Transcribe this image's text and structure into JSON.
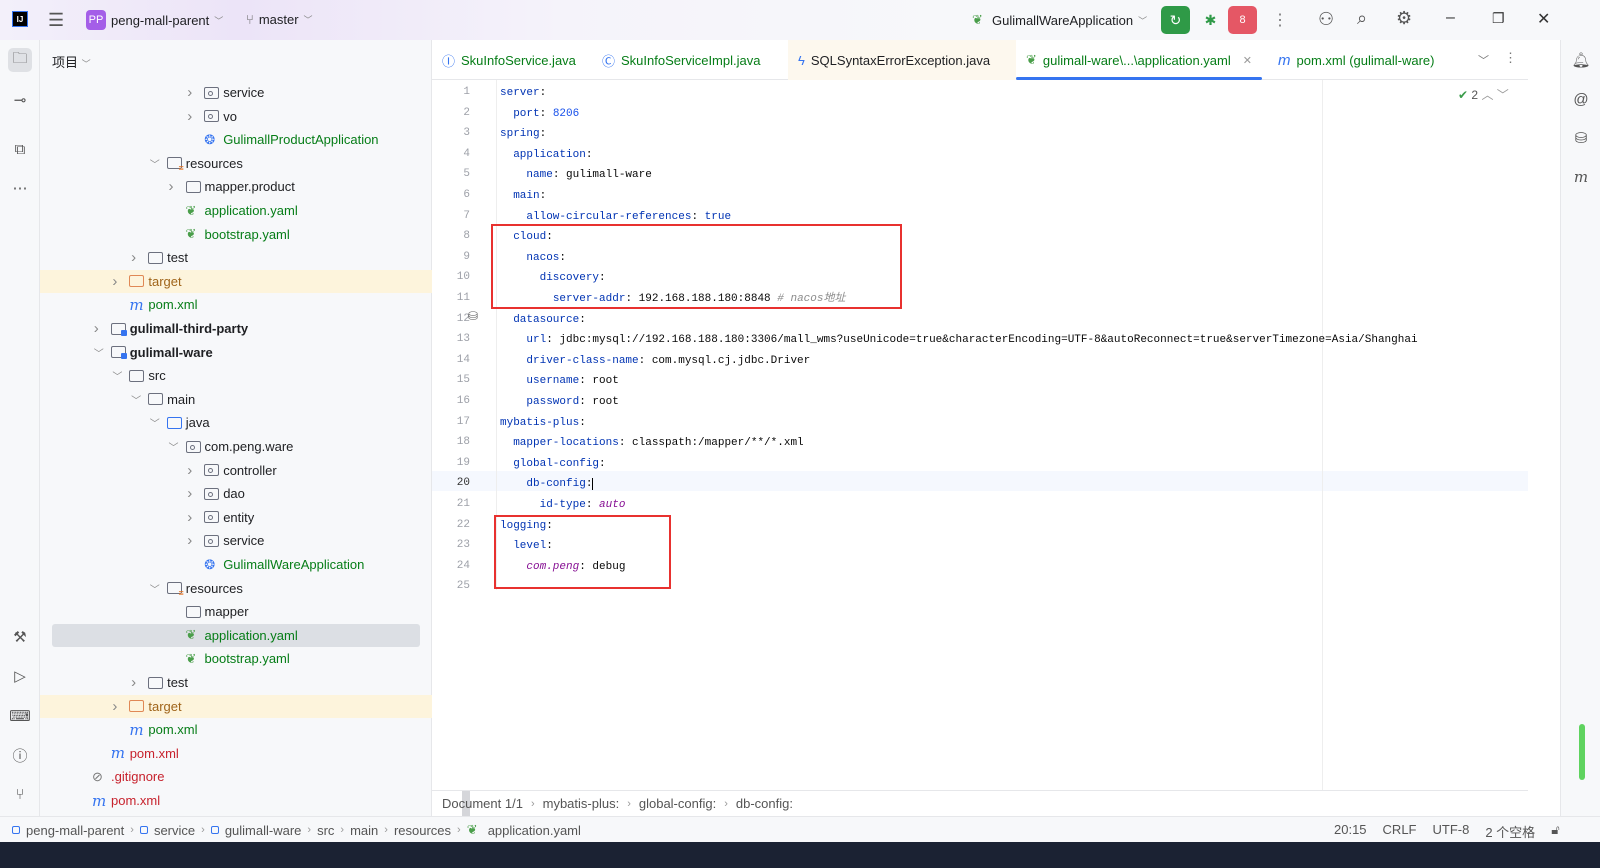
{
  "titlebar": {
    "project_badge": "PP",
    "project": "peng-mall-parent",
    "branch": "master",
    "run_config": "GulimallWareApplication",
    "debug_count": "8"
  },
  "project_panel": {
    "title": "项目"
  },
  "tree": [
    {
      "label": "service",
      "depth": 6,
      "chev": "closed",
      "icon": "package"
    },
    {
      "label": "vo",
      "depth": 6,
      "chev": "closed",
      "icon": "package"
    },
    {
      "label": "GulimallProductApplication",
      "depth": 6,
      "icon": "spring-app",
      "color": "green"
    },
    {
      "label": "resources",
      "depth": 4,
      "chev": "open",
      "icon": "resources"
    },
    {
      "label": "mapper.product",
      "depth": 5,
      "chev": "closed",
      "icon": "folder"
    },
    {
      "label": "application.yaml",
      "depth": 5,
      "icon": "yaml",
      "color": "green"
    },
    {
      "label": "bootstrap.yaml",
      "depth": 5,
      "icon": "yaml",
      "color": "green"
    },
    {
      "label": "test",
      "depth": 3,
      "chev": "closed",
      "icon": "folder"
    },
    {
      "label": "target",
      "depth": 2,
      "chev": "closed",
      "icon": "excluded-folder",
      "color": "gold",
      "highlight": true
    },
    {
      "label": "pom.xml",
      "depth": 2,
      "icon": "maven",
      "color": "green"
    },
    {
      "label": "gulimall-third-party",
      "depth": 1,
      "chev": "closed",
      "icon": "module",
      "bold": true
    },
    {
      "label": "gulimall-ware",
      "depth": 1,
      "chev": "open",
      "icon": "module",
      "bold": true
    },
    {
      "label": "src",
      "depth": 2,
      "chev": "open",
      "icon": "folder"
    },
    {
      "label": "main",
      "depth": 3,
      "chev": "open",
      "icon": "folder"
    },
    {
      "label": "java",
      "depth": 4,
      "chev": "open",
      "icon": "source-folder"
    },
    {
      "label": "com.peng.ware",
      "depth": 5,
      "chev": "open",
      "icon": "package"
    },
    {
      "label": "controller",
      "depth": 6,
      "chev": "closed",
      "icon": "package"
    },
    {
      "label": "dao",
      "depth": 6,
      "chev": "closed",
      "icon": "package"
    },
    {
      "label": "entity",
      "depth": 6,
      "chev": "closed",
      "icon": "package"
    },
    {
      "label": "service",
      "depth": 6,
      "chev": "closed",
      "icon": "package"
    },
    {
      "label": "GulimallWareApplication",
      "depth": 6,
      "icon": "spring-app",
      "color": "green"
    },
    {
      "label": "resources",
      "depth": 4,
      "chev": "open",
      "icon": "resources"
    },
    {
      "label": "mapper",
      "depth": 5,
      "icon": "folder"
    },
    {
      "label": "application.yaml",
      "depth": 5,
      "icon": "yaml",
      "color": "green",
      "selected": true
    },
    {
      "label": "bootstrap.yaml",
      "depth": 5,
      "icon": "yaml",
      "color": "green"
    },
    {
      "label": "test",
      "depth": 3,
      "chev": "closed",
      "icon": "folder"
    },
    {
      "label": "target",
      "depth": 2,
      "chev": "closed",
      "icon": "excluded-folder",
      "color": "gold",
      "highlight": true
    },
    {
      "label": "pom.xml",
      "depth": 2,
      "icon": "maven",
      "color": "green"
    },
    {
      "label": "pom.xml",
      "depth": 1,
      "icon": "maven",
      "color": "red"
    },
    {
      "label": ".gitignore",
      "depth": 0,
      "icon": "ignored",
      "color": "red"
    },
    {
      "label": "pom.xml",
      "depth": 0,
      "icon": "maven",
      "color": "red"
    }
  ],
  "tabs": [
    {
      "label": "SkuInfoService.java",
      "icon": "interface-icon"
    },
    {
      "label": "SkuInfoServiceImpl.java",
      "icon": "class-icon"
    },
    {
      "label": "SQLSyntaxErrorException.java",
      "icon": "exception-icon"
    },
    {
      "label": "gulimall-ware\\...\\application.yaml",
      "icon": "yaml-icon",
      "active": true
    },
    {
      "label": "pom.xml (gulimall-ware)",
      "icon": "maven-icon"
    }
  ],
  "inspection": {
    "count": "2"
  },
  "code": [
    [
      [
        "k",
        "server"
      ],
      [
        "v",
        ":"
      ]
    ],
    [
      [
        "v",
        "  "
      ],
      [
        "k",
        "port"
      ],
      [
        "v",
        ": "
      ],
      [
        "n",
        "8206"
      ]
    ],
    [
      [
        "k",
        "spring"
      ],
      [
        "v",
        ":"
      ]
    ],
    [
      [
        "v",
        "  "
      ],
      [
        "k",
        "application"
      ],
      [
        "v",
        ":"
      ]
    ],
    [
      [
        "v",
        "    "
      ],
      [
        "k",
        "name"
      ],
      [
        "v",
        ": gulimall-ware"
      ]
    ],
    [
      [
        "v",
        "  "
      ],
      [
        "k",
        "main"
      ],
      [
        "v",
        ":"
      ]
    ],
    [
      [
        "v",
        "    "
      ],
      [
        "k",
        "allow-circular-references"
      ],
      [
        "v",
        ": "
      ],
      [
        "b",
        "true"
      ]
    ],
    [
      [
        "v",
        "  "
      ],
      [
        "k",
        "cloud"
      ],
      [
        "v",
        ":"
      ]
    ],
    [
      [
        "v",
        "    "
      ],
      [
        "k",
        "nacos"
      ],
      [
        "v",
        ":"
      ]
    ],
    [
      [
        "v",
        "      "
      ],
      [
        "k",
        "discovery"
      ],
      [
        "v",
        ":"
      ]
    ],
    [
      [
        "v",
        "        "
      ],
      [
        "k",
        "server-addr"
      ],
      [
        "v",
        ": 192.168.188.180:8848 "
      ],
      [
        "c",
        "# nacos地址"
      ]
    ],
    [
      [
        "v",
        "  "
      ],
      [
        "k",
        "datasource"
      ],
      [
        "v",
        ":"
      ]
    ],
    [
      [
        "v",
        "    "
      ],
      [
        "k",
        "url"
      ],
      [
        "v",
        ": jdbc:mysql://192.168.188.180:3306/mall_wms?useUnicode=true&characterEncoding=UTF-8&autoReconnect=true&serverTimezone=Asia/Shanghai"
      ]
    ],
    [
      [
        "v",
        "    "
      ],
      [
        "k",
        "driver-class-name"
      ],
      [
        "v",
        ": com.mysql.cj.jdbc.Driver"
      ]
    ],
    [
      [
        "v",
        "    "
      ],
      [
        "k",
        "username"
      ],
      [
        "v",
        ": root"
      ]
    ],
    [
      [
        "v",
        "    "
      ],
      [
        "k",
        "password"
      ],
      [
        "v",
        ": root"
      ]
    ],
    [
      [
        "k",
        "mybatis-plus"
      ],
      [
        "v",
        ":"
      ]
    ],
    [
      [
        "v",
        "  "
      ],
      [
        "k",
        "mapper-locations"
      ],
      [
        "v",
        ": classpath:/mapper/**/*.xml"
      ]
    ],
    [
      [
        "v",
        "  "
      ],
      [
        "k",
        "global-config"
      ],
      [
        "v",
        ":"
      ]
    ],
    [
      [
        "v",
        "    "
      ],
      [
        "k",
        "db-config"
      ],
      [
        "v",
        ":"
      ]
    ],
    [
      [
        "v",
        "      "
      ],
      [
        "k",
        "id-type"
      ],
      [
        "v",
        ": "
      ],
      [
        "p",
        "auto"
      ]
    ],
    [
      [
        "k",
        "logging"
      ],
      [
        "v",
        ":"
      ]
    ],
    [
      [
        "v",
        "  "
      ],
      [
        "k",
        "level"
      ],
      [
        "v",
        ":"
      ]
    ],
    [
      [
        "v",
        "    "
      ],
      [
        "p",
        "com.peng"
      ],
      [
        "v",
        ": debug"
      ]
    ],
    []
  ],
  "editor_breadcrumb": [
    "Document 1/1",
    "mybatis-plus:",
    "global-config:",
    "db-config:"
  ],
  "status_path": [
    "peng-mall-parent",
    "service",
    "gulimall-ware",
    "src",
    "main",
    "resources",
    "application.yaml"
  ],
  "status_right": {
    "position": "20:15",
    "line_sep": "CRLF",
    "encoding": "UTF-8",
    "indent": "2 个空格"
  }
}
